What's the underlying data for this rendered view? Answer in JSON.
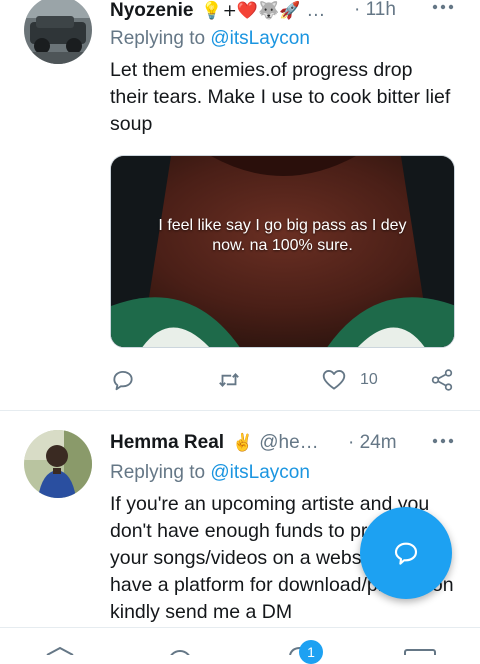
{
  "tweets": [
    {
      "name": "Nyozenie",
      "emojis": "💡+❤️🐺🚀",
      "handle": "…",
      "time": "· 11h",
      "reply_prefix": "Replying to",
      "reply_to": "@itsLaycon",
      "text": "Let them enemies.of progress drop their tears. Make I use to cook bitter lief soup",
      "media_caption": "I feel like say I go big pass as I dey now. na 100% sure.",
      "like_count": "10"
    },
    {
      "name": "Hemma Real",
      "emojis": "✌️",
      "handle": "@he…",
      "time": "· 24m",
      "reply_prefix": "Replying to",
      "reply_to": "@itsLaycon",
      "text": "If you're an upcoming artiste and you don't have enough funds to promote your songs/videos on a website, we have a platform for download/promotion kindly send me a DM"
    }
  ],
  "more_icon": "more-dots-icon",
  "bottom_nav": {
    "notification_count": "1",
    "icons": [
      "home-icon",
      "search-icon",
      "notifications-icon",
      "messages-icon"
    ]
  },
  "colors": {
    "accent": "#1da1f2",
    "mention": "#1b95e0",
    "secondary_text": "#657786",
    "divider": "#e6ecf0"
  }
}
